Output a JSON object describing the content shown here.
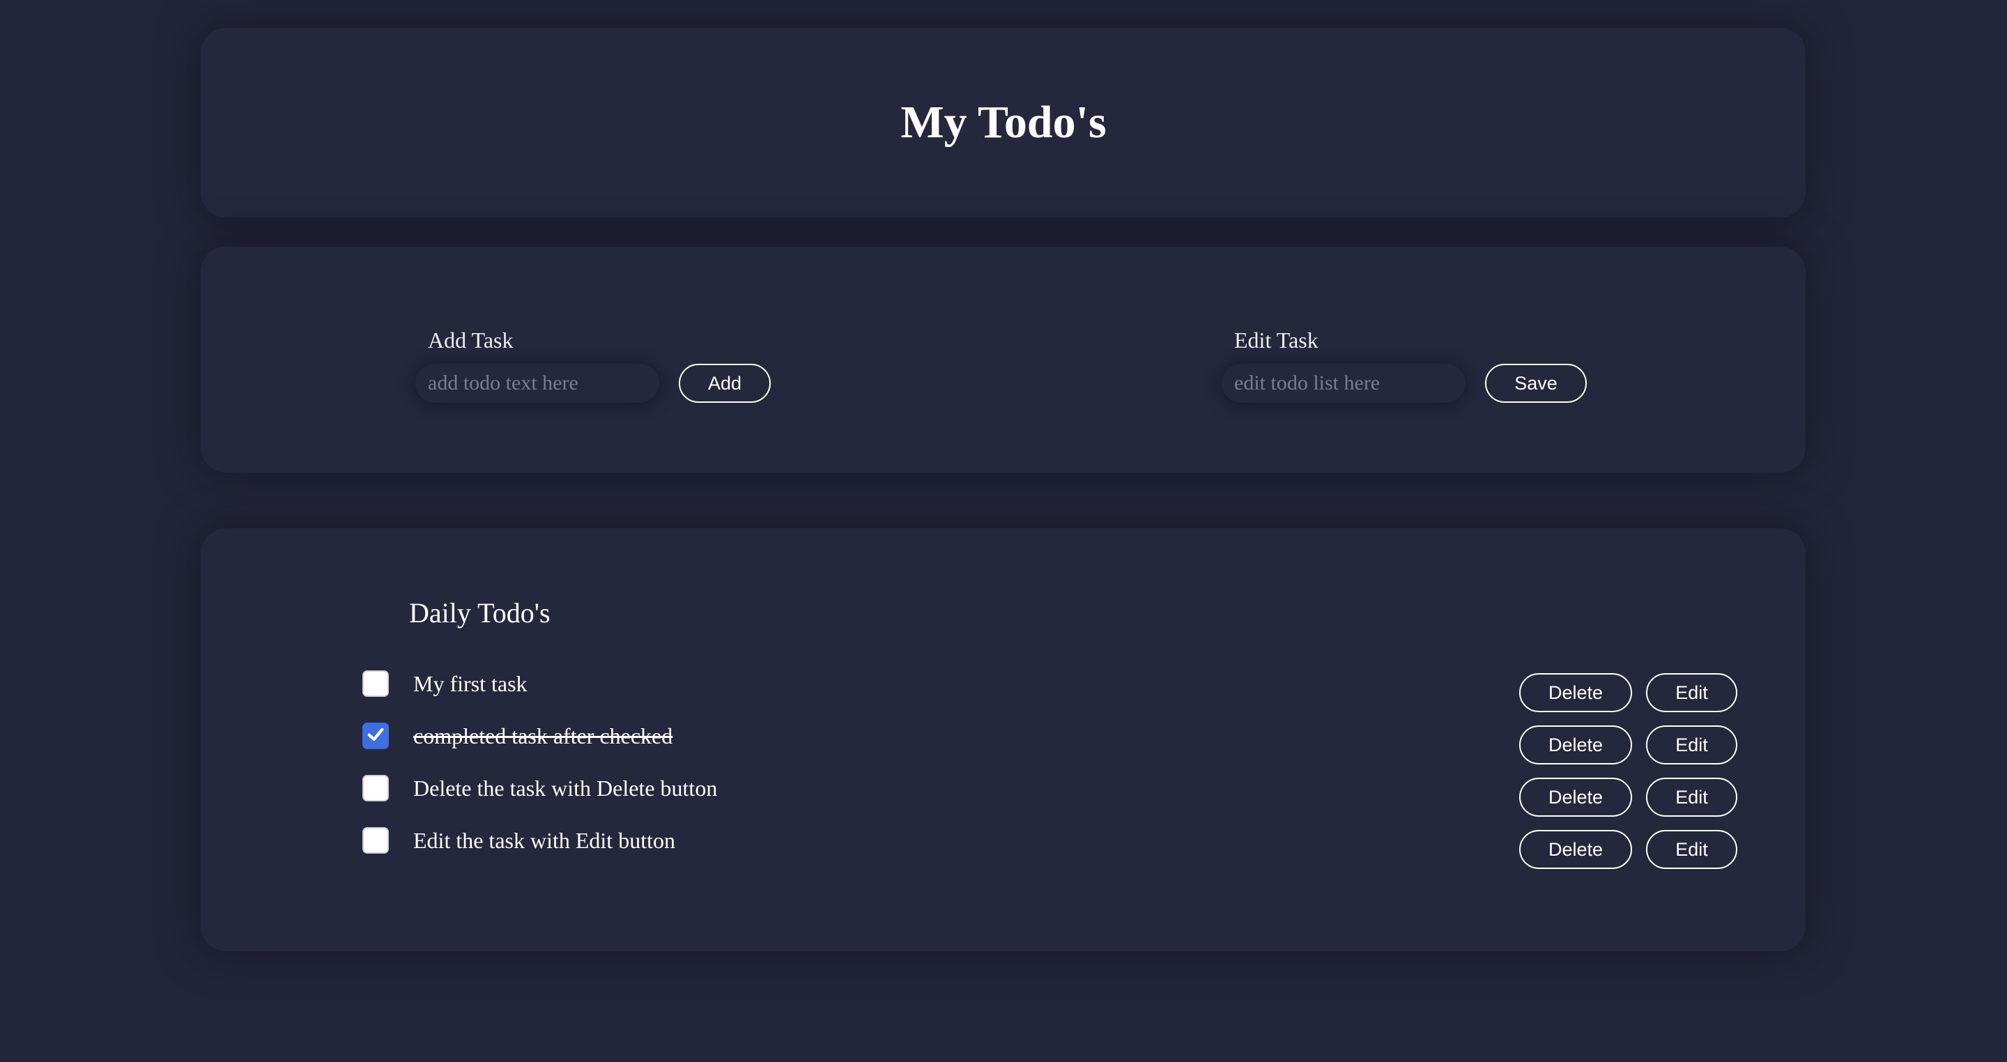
{
  "header": {
    "title": "My Todo's"
  },
  "add_form": {
    "label": "Add Task",
    "placeholder": "add todo text here",
    "value": "",
    "button_label": "Add"
  },
  "edit_form": {
    "label": "Edit Task",
    "placeholder": "edit todo list here",
    "value": "",
    "button_label": "Save"
  },
  "todo_list": {
    "title": "Daily Todo's",
    "delete_label": "Delete",
    "edit_label": "Edit",
    "items": [
      {
        "text": "My first task",
        "completed": false
      },
      {
        "text": "completed task after checked",
        "completed": true
      },
      {
        "text": "Delete the task with Delete button",
        "completed": false
      },
      {
        "text": "Edit the task with Edit button",
        "completed": false
      }
    ]
  },
  "colors": {
    "background": "#23253a",
    "card": "#25273c",
    "checkbox_checked": "#3d6fe0",
    "text": "#ffffff"
  }
}
